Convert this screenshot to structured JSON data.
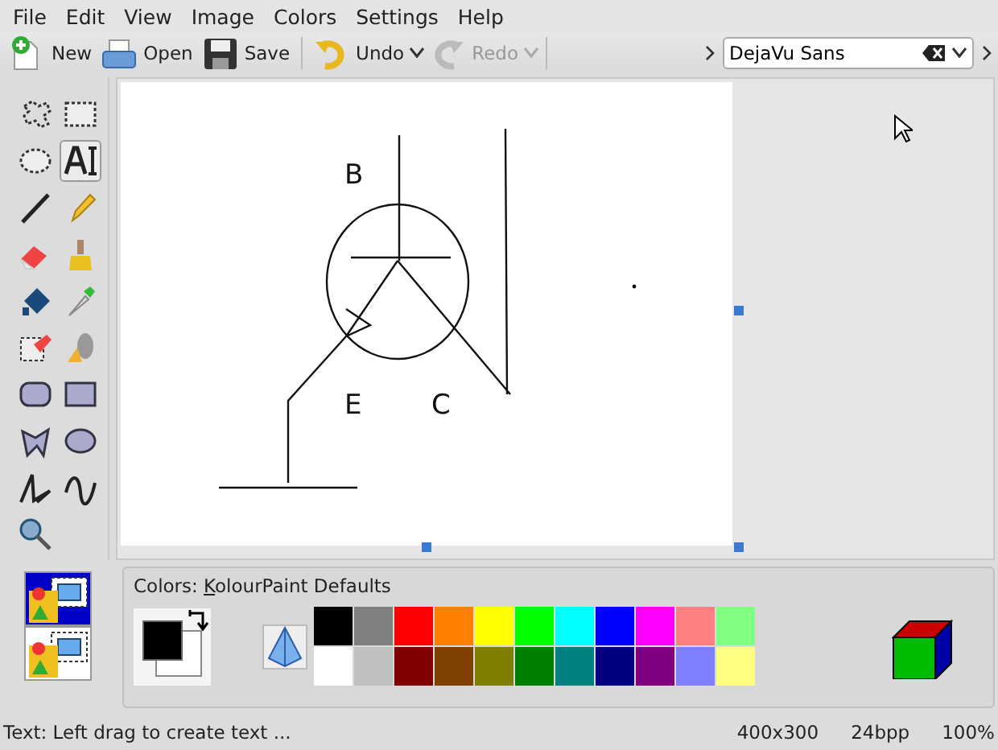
{
  "menu": [
    "File",
    "Edit",
    "View",
    "Image",
    "Colors",
    "Settings",
    "Help"
  ],
  "toolbar": [
    {
      "kind": "new",
      "label": "New",
      "disabled": false,
      "dropdown": false
    },
    {
      "kind": "open",
      "label": "Open",
      "disabled": false,
      "dropdown": false
    },
    {
      "kind": "save",
      "label": "Save",
      "disabled": false,
      "dropdown": false
    },
    {
      "kind": "undo",
      "label": "Undo",
      "disabled": false,
      "dropdown": true
    },
    {
      "kind": "redo",
      "label": "Redo",
      "disabled": true,
      "dropdown": true
    }
  ],
  "font_field": {
    "value": "DejaVu Sans"
  },
  "tools": [
    {
      "kind": "free-select",
      "selected": false
    },
    {
      "kind": "rect-select",
      "selected": false
    },
    {
      "kind": "ellipse-select",
      "selected": false
    },
    {
      "kind": "text",
      "selected": true
    },
    {
      "kind": "line",
      "selected": false
    },
    {
      "kind": "pen",
      "selected": false
    },
    {
      "kind": "eraser",
      "selected": false
    },
    {
      "kind": "brush",
      "selected": false
    },
    {
      "kind": "fill",
      "selected": false
    },
    {
      "kind": "picker",
      "selected": false
    },
    {
      "kind": "color-eraser",
      "selected": false
    },
    {
      "kind": "spray",
      "selected": false
    },
    {
      "kind": "round-rect",
      "selected": false
    },
    {
      "kind": "rect",
      "selected": false
    },
    {
      "kind": "polygon",
      "selected": false
    },
    {
      "kind": "ellipse",
      "selected": false
    },
    {
      "kind": "polyline",
      "selected": false
    },
    {
      "kind": "curve",
      "selected": false
    },
    {
      "kind": "zoom",
      "selected": false
    }
  ],
  "selection_modes": [
    {
      "selected": true
    },
    {
      "selected": false
    }
  ],
  "canvas": {
    "labels": [
      "B",
      "E",
      "C"
    ]
  },
  "colors_panel": {
    "title_prefix": "Colors: ",
    "title_key": "K",
    "title_rest": "olourPaint Defaults",
    "palette": [
      {
        "color": "#000000"
      },
      {
        "color": "#808080"
      },
      {
        "color": "#ff0000"
      },
      {
        "color": "#ff8000"
      },
      {
        "color": "#ffff00"
      },
      {
        "color": "#00ff00"
      },
      {
        "color": "#00ffff"
      },
      {
        "color": "#0000ff"
      },
      {
        "color": "#ff00ff"
      },
      {
        "color": "#ff8080"
      },
      {
        "color": "#80ff80"
      },
      {
        "color": "#ffffff"
      },
      {
        "color": "#c0c0c0"
      },
      {
        "color": "#800000"
      },
      {
        "color": "#804000"
      },
      {
        "color": "#808000"
      },
      {
        "color": "#008000"
      },
      {
        "color": "#008080"
      },
      {
        "color": "#000080"
      },
      {
        "color": "#800080"
      },
      {
        "color": "#8080ff"
      },
      {
        "color": "#ffff80"
      }
    ]
  },
  "status_bar": {
    "message": "Text: Left drag to create text ...",
    "size": "400x300",
    "depth": "24bpp",
    "zoom": "100%"
  }
}
